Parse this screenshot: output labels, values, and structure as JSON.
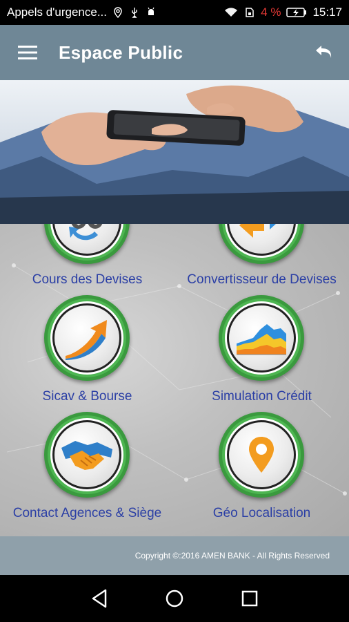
{
  "status_bar": {
    "notification_text": "Appels d'urgence...",
    "battery_percent": "4 %",
    "time": "15:17",
    "icons": [
      "location-icon",
      "usb-icon",
      "android-debug-icon",
      "wifi-icon",
      "sim-icon",
      "battery-charging-icon"
    ]
  },
  "app_bar": {
    "title": "Espace Public",
    "menu_icon": "hamburger-menu-icon",
    "back_icon": "back-arrow-icon",
    "color": "#6f8796"
  },
  "tiles": [
    {
      "label": "Cours des Devises",
      "icon": "currency-exchange-icon"
    },
    {
      "label": "Convertisseur de Devises",
      "icon": "converter-arrows-icon"
    },
    {
      "label": "Sicav & Bourse",
      "icon": "stock-growth-icon"
    },
    {
      "label": "Simulation Crédit",
      "icon": "area-chart-icon"
    },
    {
      "label": "Contact Agences & Siège",
      "icon": "handshake-icon"
    },
    {
      "label": "Géo Localisation",
      "icon": "location-pin-icon"
    }
  ],
  "footer": {
    "copyright": "Copyright ©:2016 AMEN BANK - All Rights Reserved"
  },
  "nav_bar": {
    "icons": [
      "nav-back-icon",
      "nav-home-icon",
      "nav-recents-icon"
    ]
  },
  "colors": {
    "label_blue": "#2b3fa5",
    "ring_green": "#4db551",
    "footer_bg": "#8fa0aa"
  }
}
